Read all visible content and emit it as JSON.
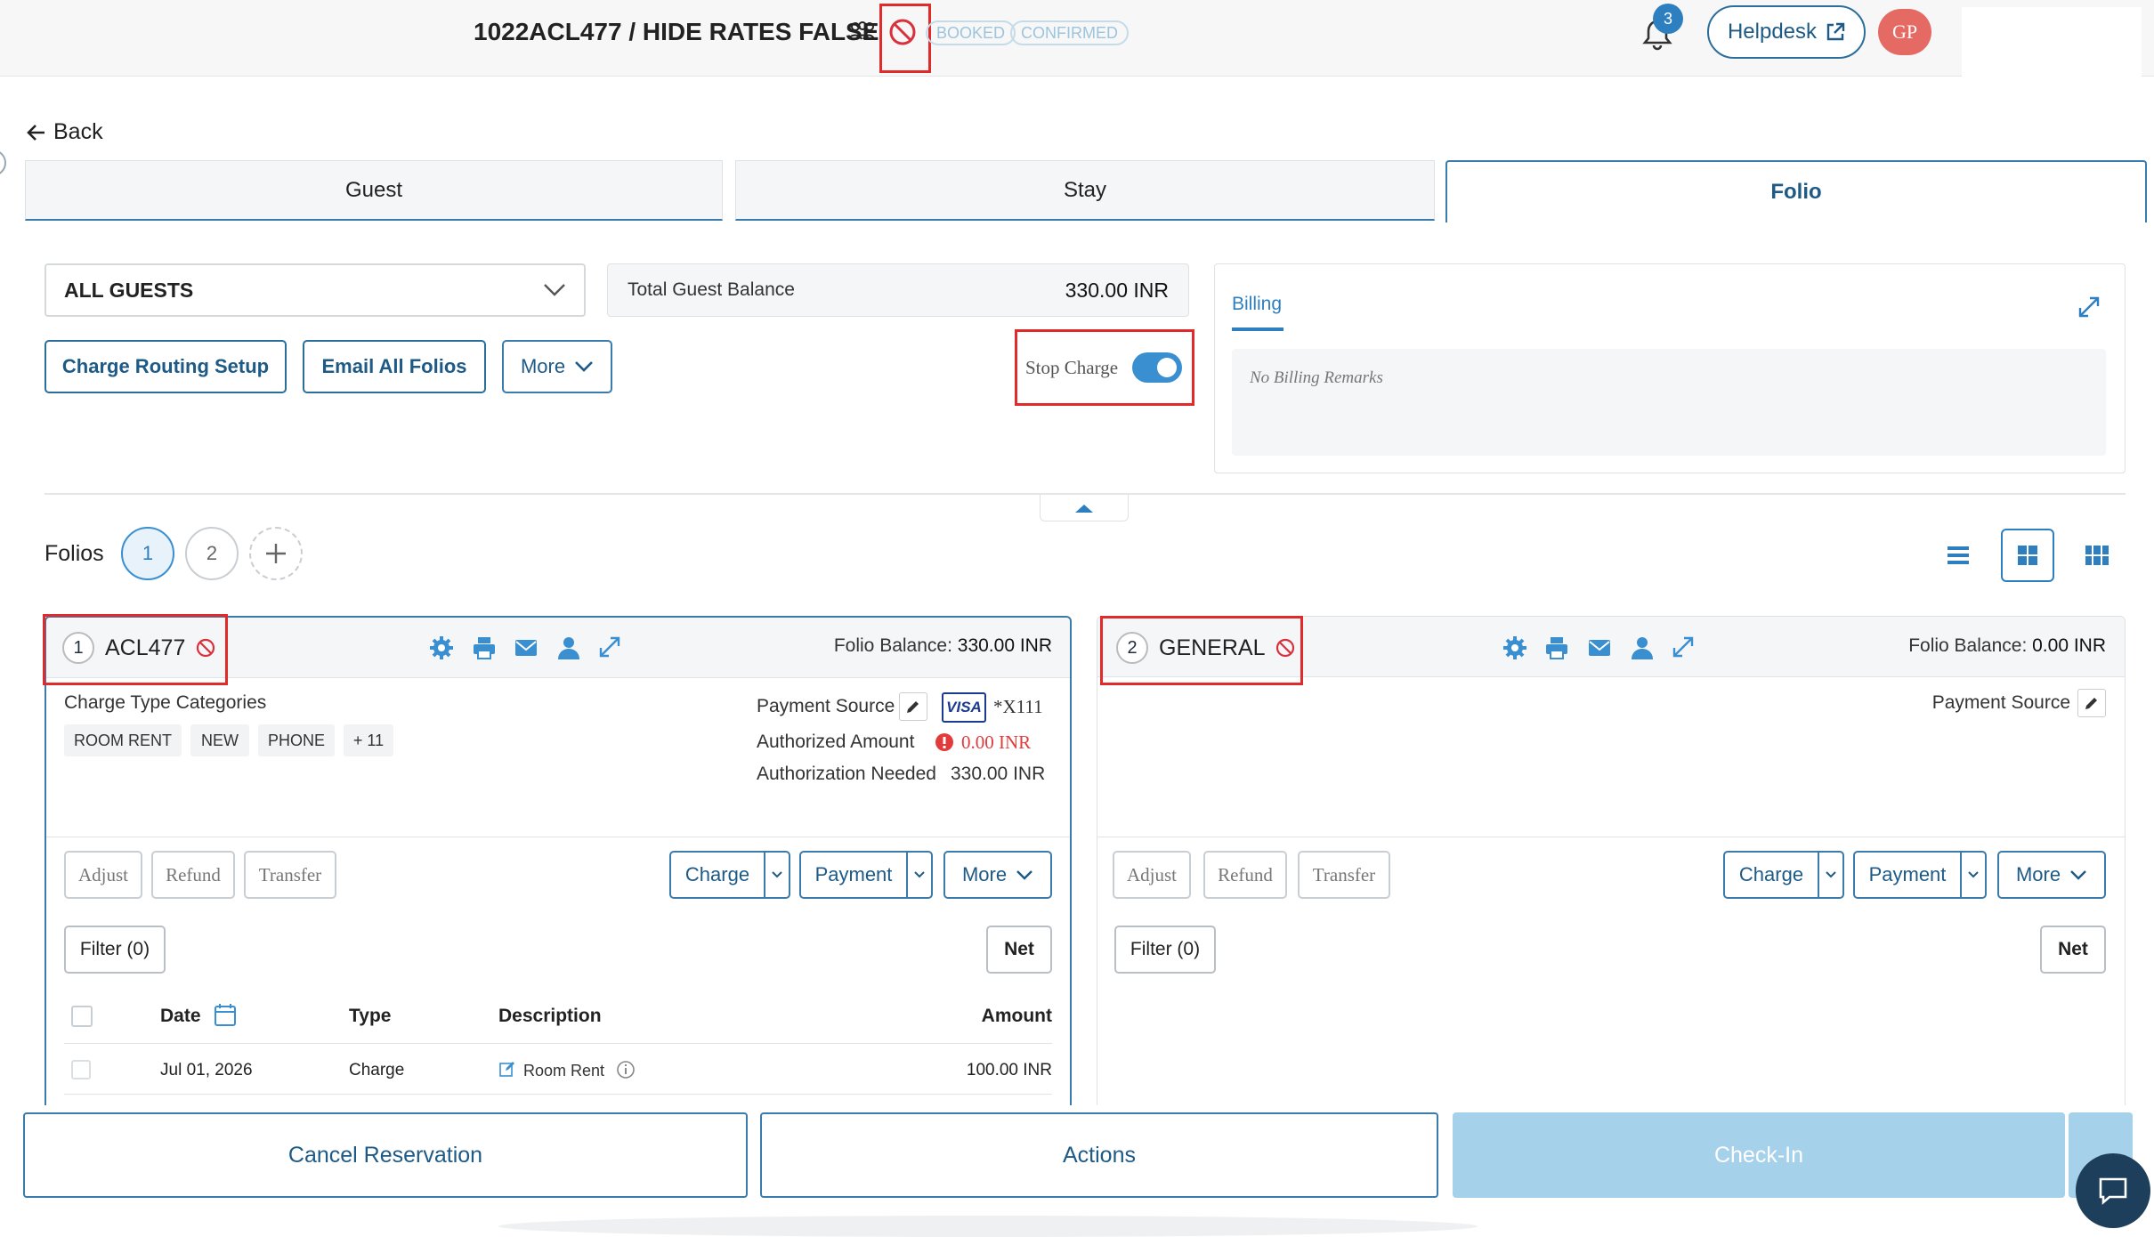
{
  "header": {
    "reservation_code": "1022ACL477",
    "separator_title": " / HIDE RATES FALSE",
    "badges": [
      "BOOKED",
      "CONFIRMED"
    ],
    "notification_count": "3",
    "helpdesk_label": "Helpdesk",
    "avatar_initials": "GP"
  },
  "nav": {
    "back_label": "Back"
  },
  "tabs": [
    {
      "label": "Guest"
    },
    {
      "label": "Stay"
    },
    {
      "label": "Folio",
      "active": true
    }
  ],
  "guest_select": {
    "value": "ALL GUESTS"
  },
  "balance": {
    "label": "Total Guest Balance",
    "value": "330.00 INR"
  },
  "actions": {
    "charge_routing": "Charge Routing Setup",
    "email_all": "Email All Folios",
    "more": "More"
  },
  "stop_charge": {
    "label": "Stop Charge",
    "enabled": true
  },
  "billing": {
    "tab_label": "Billing",
    "remarks": "No Billing Remarks"
  },
  "folios_section": {
    "label": "Folios",
    "numbers": [
      "1",
      "2"
    ]
  },
  "folio1": {
    "number": "1",
    "name": "ACL477",
    "balance_label": "Folio Balance:",
    "balance_value": "330.00 INR",
    "charge_type_label": "Charge Type Categories",
    "chips": [
      "ROOM RENT",
      "NEW",
      "PHONE",
      "+ 11"
    ],
    "payment_source_label": "Payment Source",
    "card_brand": "VISA",
    "card_last": "*X111",
    "authorized_label": "Authorized Amount",
    "authorized_value": "0.00 INR",
    "auth_needed_label": "Authorization Needed",
    "auth_needed_value": "330.00 INR",
    "buttons": {
      "adjust": "Adjust",
      "refund": "Refund",
      "transfer": "Transfer",
      "charge": "Charge",
      "payment": "Payment",
      "more": "More",
      "filter": "Filter (0)",
      "net": "Net"
    },
    "table": {
      "headers": [
        "Date",
        "Type",
        "Description",
        "Amount"
      ],
      "rows": [
        {
          "date": "Jul 01, 2026",
          "type": "Charge",
          "description": "Room Rent",
          "amount": "100.00 INR"
        }
      ]
    }
  },
  "folio2": {
    "number": "2",
    "name": "GENERAL",
    "balance_label": "Folio Balance:",
    "balance_value": "0.00 INR",
    "payment_source_label": "Payment Source",
    "buttons": {
      "adjust": "Adjust",
      "refund": "Refund",
      "transfer": "Transfer",
      "charge": "Charge",
      "payment": "Payment",
      "more": "More",
      "filter": "Filter (0)",
      "net": "Net"
    }
  },
  "footer": {
    "cancel": "Cancel Reservation",
    "actions": "Actions",
    "checkin": "Check-In"
  },
  "colors": {
    "accent": "#1d5a86",
    "primary_blue": "#3b7bab",
    "toggle": "#3a8fd1",
    "highlight": "#e02b2b",
    "checkin_disabled": "#a6d1ea",
    "chat_bubble": "#1d3f5c",
    "avatar": "#e46a63"
  }
}
